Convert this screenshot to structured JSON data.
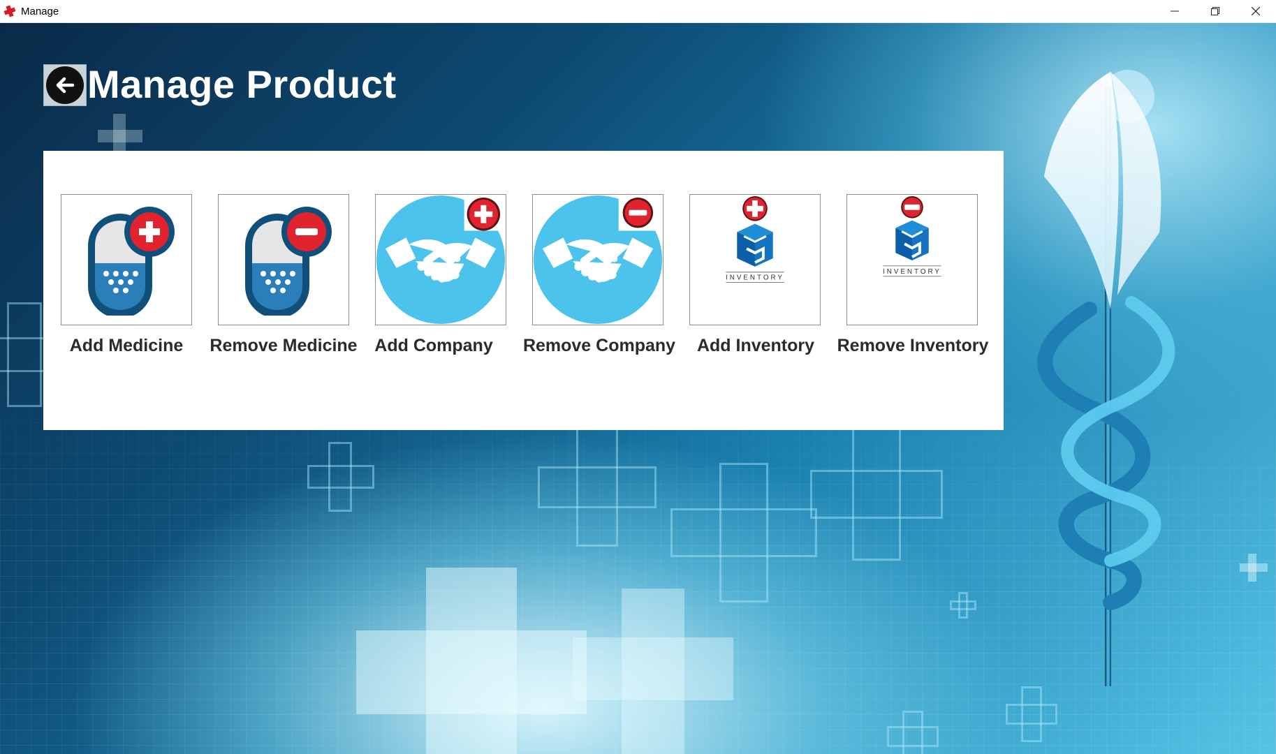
{
  "window": {
    "title": "Manage",
    "controls": {
      "minimize": "minimize-icon",
      "restore": "restore-icon",
      "close": "close-icon"
    }
  },
  "header": {
    "back_icon": "back-arrow-icon",
    "title": "Manage Product"
  },
  "actions": [
    {
      "id": "add-medicine",
      "label": "Add Medicine",
      "icon": "capsule-plus-icon"
    },
    {
      "id": "remove-medicine",
      "label": "Remove Medicine",
      "icon": "capsule-minus-icon"
    },
    {
      "id": "add-company",
      "label": "Add Company",
      "icon": "handshake-plus-icon"
    },
    {
      "id": "remove-company",
      "label": "Remove Company",
      "icon": "handshake-minus-icon"
    },
    {
      "id": "add-inventory",
      "label": "Add Inventory",
      "icon": "inventory-box-plus-icon",
      "logo_text": "INVENTORY"
    },
    {
      "id": "remove-inventory",
      "label": "Remove Inventory",
      "icon": "inventory-box-minus-icon",
      "logo_text": "INVENTORY"
    }
  ],
  "colors": {
    "accent_red": "#e0232e",
    "capsule_blue": "#0f5a8c",
    "handshake_blue": "#4cc3ec",
    "title_text": "#ffffff",
    "label_text": "#2b2b2b"
  }
}
